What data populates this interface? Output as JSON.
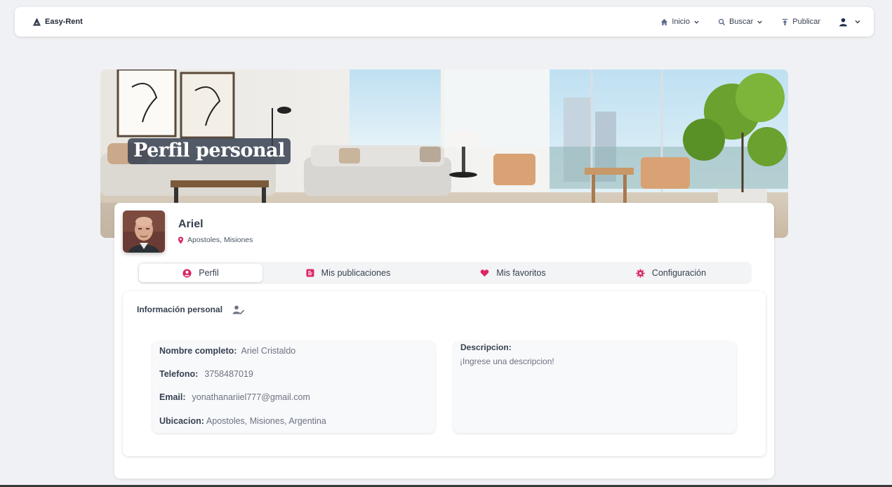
{
  "navbar": {
    "brand": "Easy-Rent",
    "items": [
      {
        "label": "Inicio",
        "icon": "home-icon"
      },
      {
        "label": "Buscar",
        "icon": "search-icon"
      },
      {
        "label": "Publicar",
        "icon": "upload-icon"
      }
    ],
    "user_icon": "user-icon"
  },
  "hero": {
    "title": "Perfil personal"
  },
  "profile": {
    "name": "Ariel",
    "location": "Apostoles, Misiones"
  },
  "tabs": [
    {
      "label": "Perfil",
      "icon": "user-circle-icon",
      "active": true
    },
    {
      "label": "Mis publicaciones",
      "icon": "document-icon",
      "active": false
    },
    {
      "label": "Mis favoritos",
      "icon": "heart-icon",
      "active": false
    },
    {
      "label": "Configuración",
      "icon": "gear-icon",
      "active": false
    }
  ],
  "info": {
    "title": "Información personal",
    "fields": [
      {
        "label": "Nombre completo:",
        "value": "Ariel Cristaldo"
      },
      {
        "label": "Telefono:",
        "value": "3758487019"
      },
      {
        "label": "Email:",
        "value": "yonathanariiel777@gmail.com"
      },
      {
        "label": "Ubicacion:",
        "value": "Apostoles, Misiones, Argentina"
      }
    ],
    "description_label": "Descripcion:",
    "description_placeholder": "¡Ingrese una descripcion!"
  },
  "colors": {
    "accent": "#db2763",
    "text": "#374151",
    "nav_icon": "#5b6b8c"
  }
}
